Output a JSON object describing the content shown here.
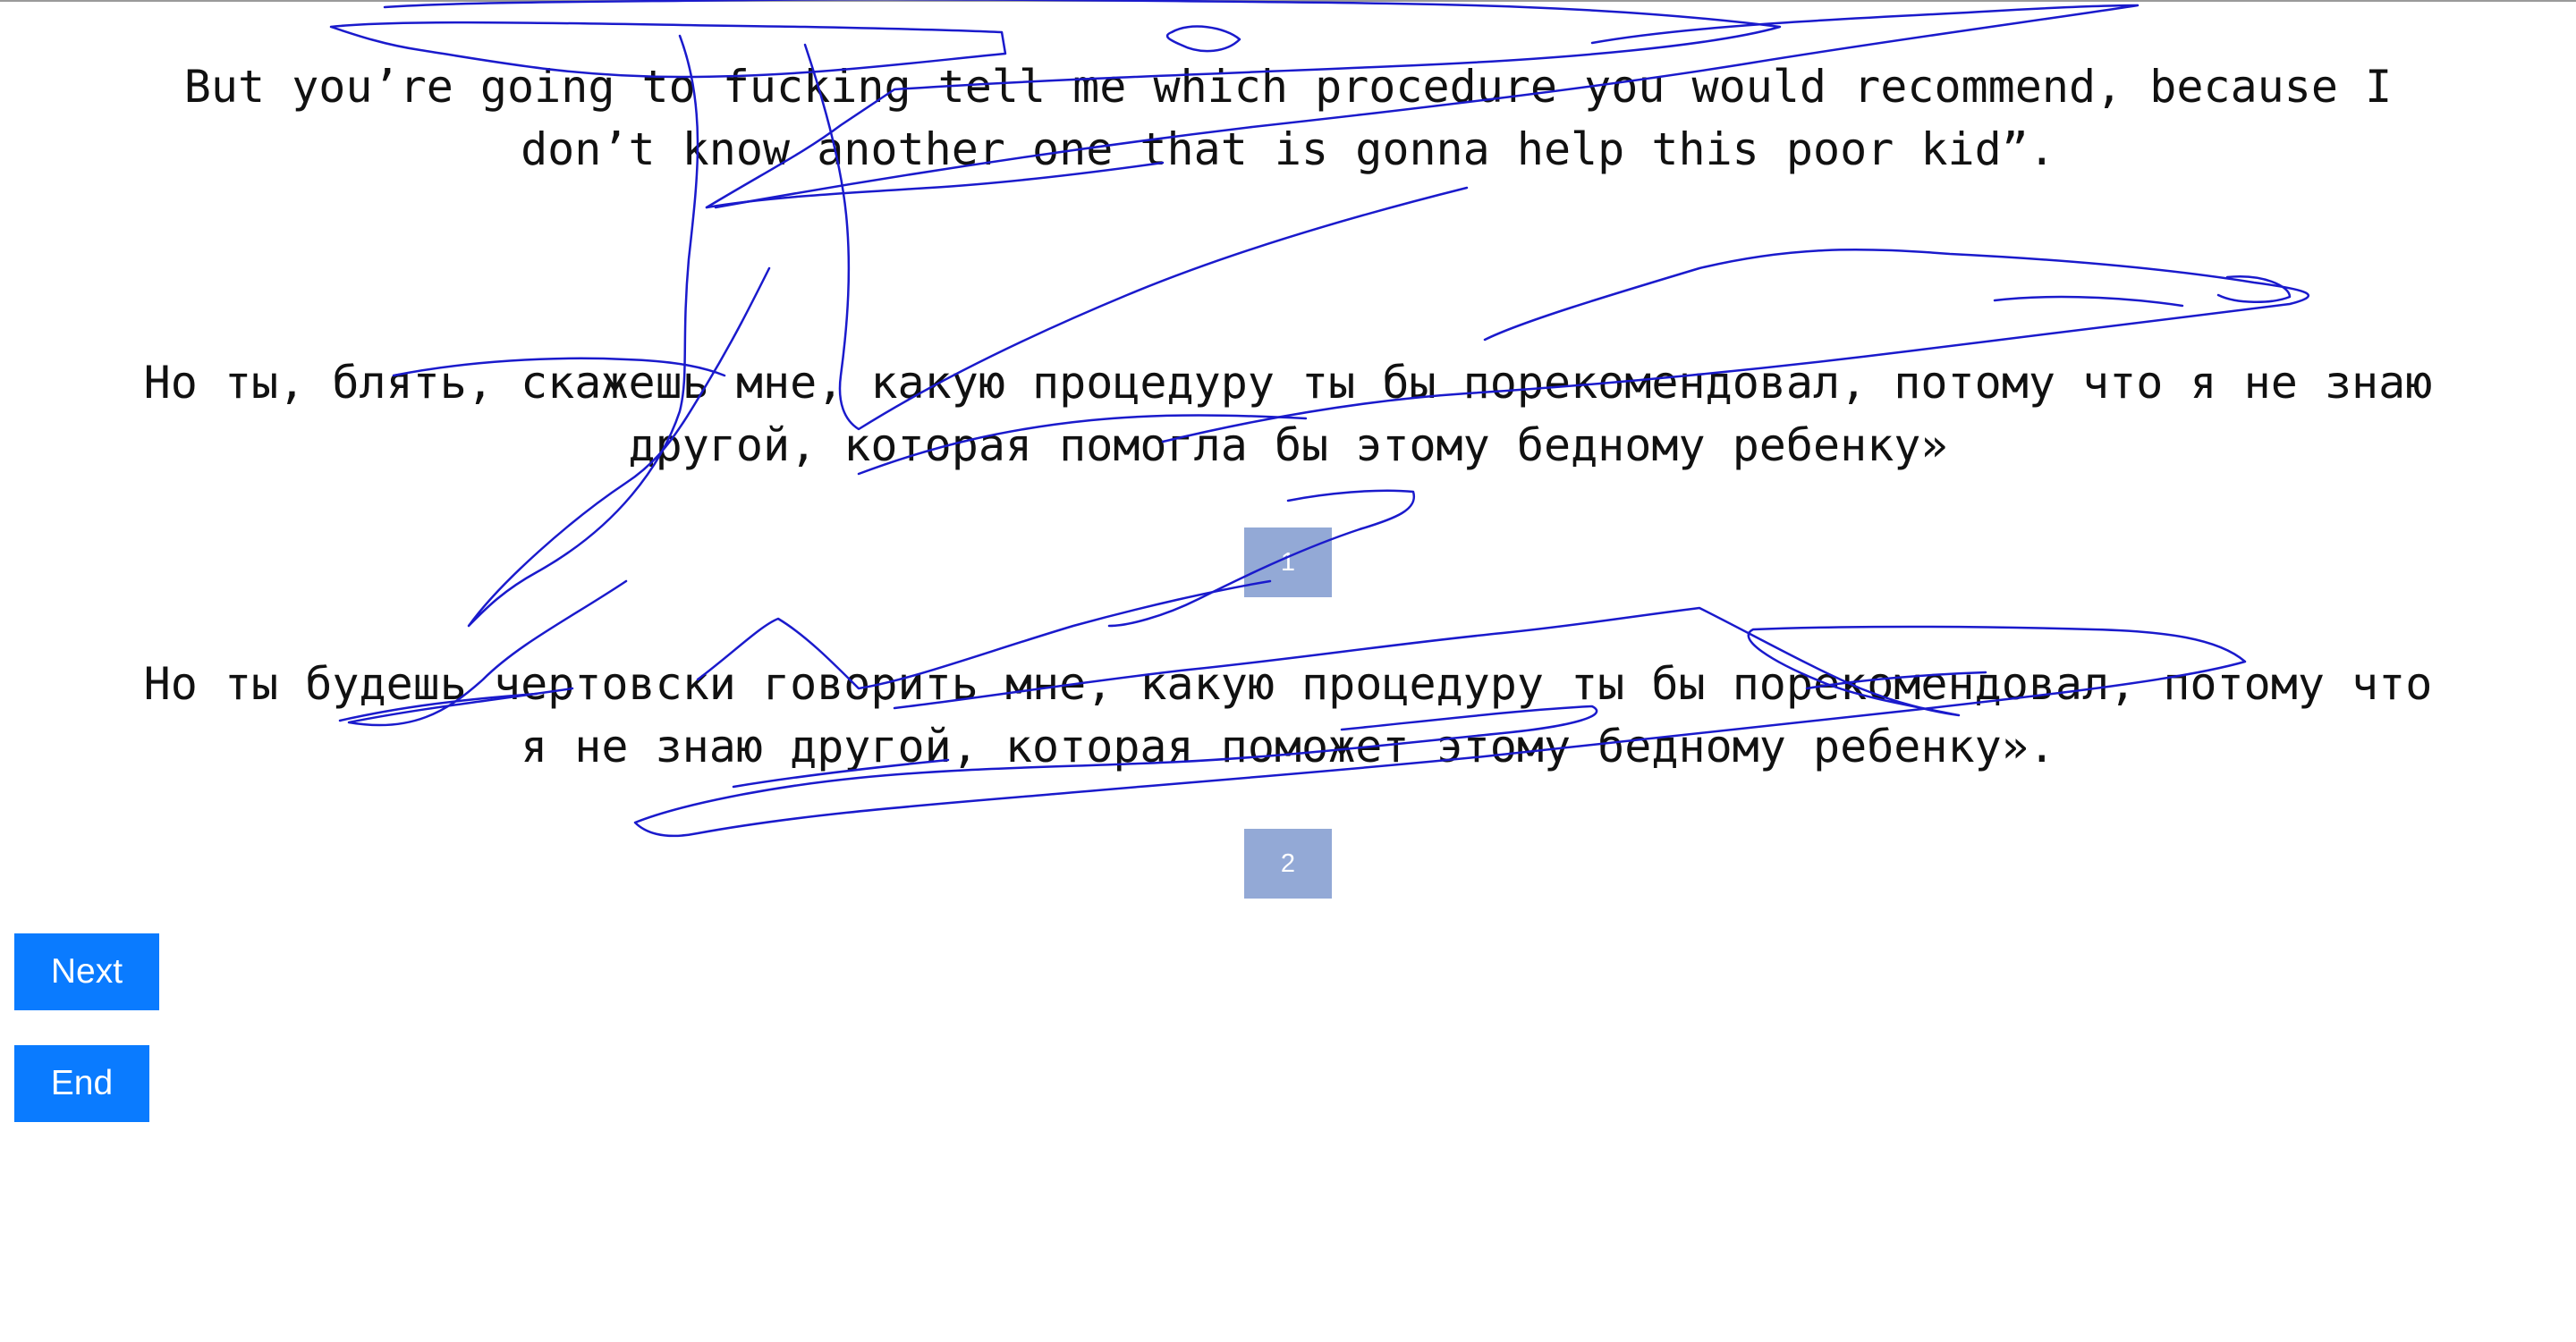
{
  "source": {
    "text": "But you’re going to fucking tell me which procedure you would recommend, because I\ndon’t know another one that is gonna help this poor kid”."
  },
  "translations": [
    {
      "text": "Но ты, блять, скажешь мне, какую процедуру ты бы порекомендовал, потому что я не знаю\nдругой, которая помогла бы этому бедному ребенку»",
      "button_label": "1"
    },
    {
      "text": "Но ты будешь чертовски говорить мне, какую процедуру ты бы порекомендовал, потому что\nя не знаю другой, которая поможет этому бедному ребенку».",
      "button_label": "2"
    }
  ],
  "actions": {
    "next_label": "Next",
    "end_label": "End"
  },
  "colors": {
    "choice_button": "#93a9d6",
    "action_button": "#0a7bff",
    "scribble": "#1a1acc"
  }
}
